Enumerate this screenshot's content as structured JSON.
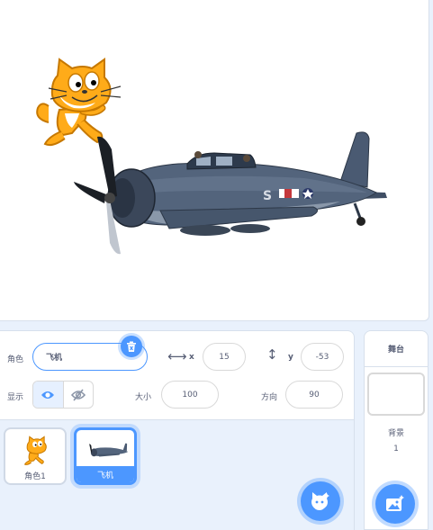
{
  "sprite_info": {
    "sprite_label": "角色",
    "sprite_name": "飞机",
    "x_label": "x",
    "x_value": "15",
    "y_label": "y",
    "y_value": "-53",
    "show_label": "显示",
    "size_label": "大小",
    "size_value": "100",
    "direction_label": "方向",
    "direction_value": "90"
  },
  "sprites": [
    {
      "name": "角色1",
      "icon": "cat-sprite",
      "selected": false
    },
    {
      "name": "飞机",
      "icon": "plane-sprite",
      "selected": true
    }
  ],
  "stage_panel": {
    "title": "舞台",
    "backdrops_label": "背景",
    "backdrops_count": "1"
  },
  "colors": {
    "accent": "#4c97ff",
    "background": "#e9f1fc",
    "text": "#575e75"
  }
}
